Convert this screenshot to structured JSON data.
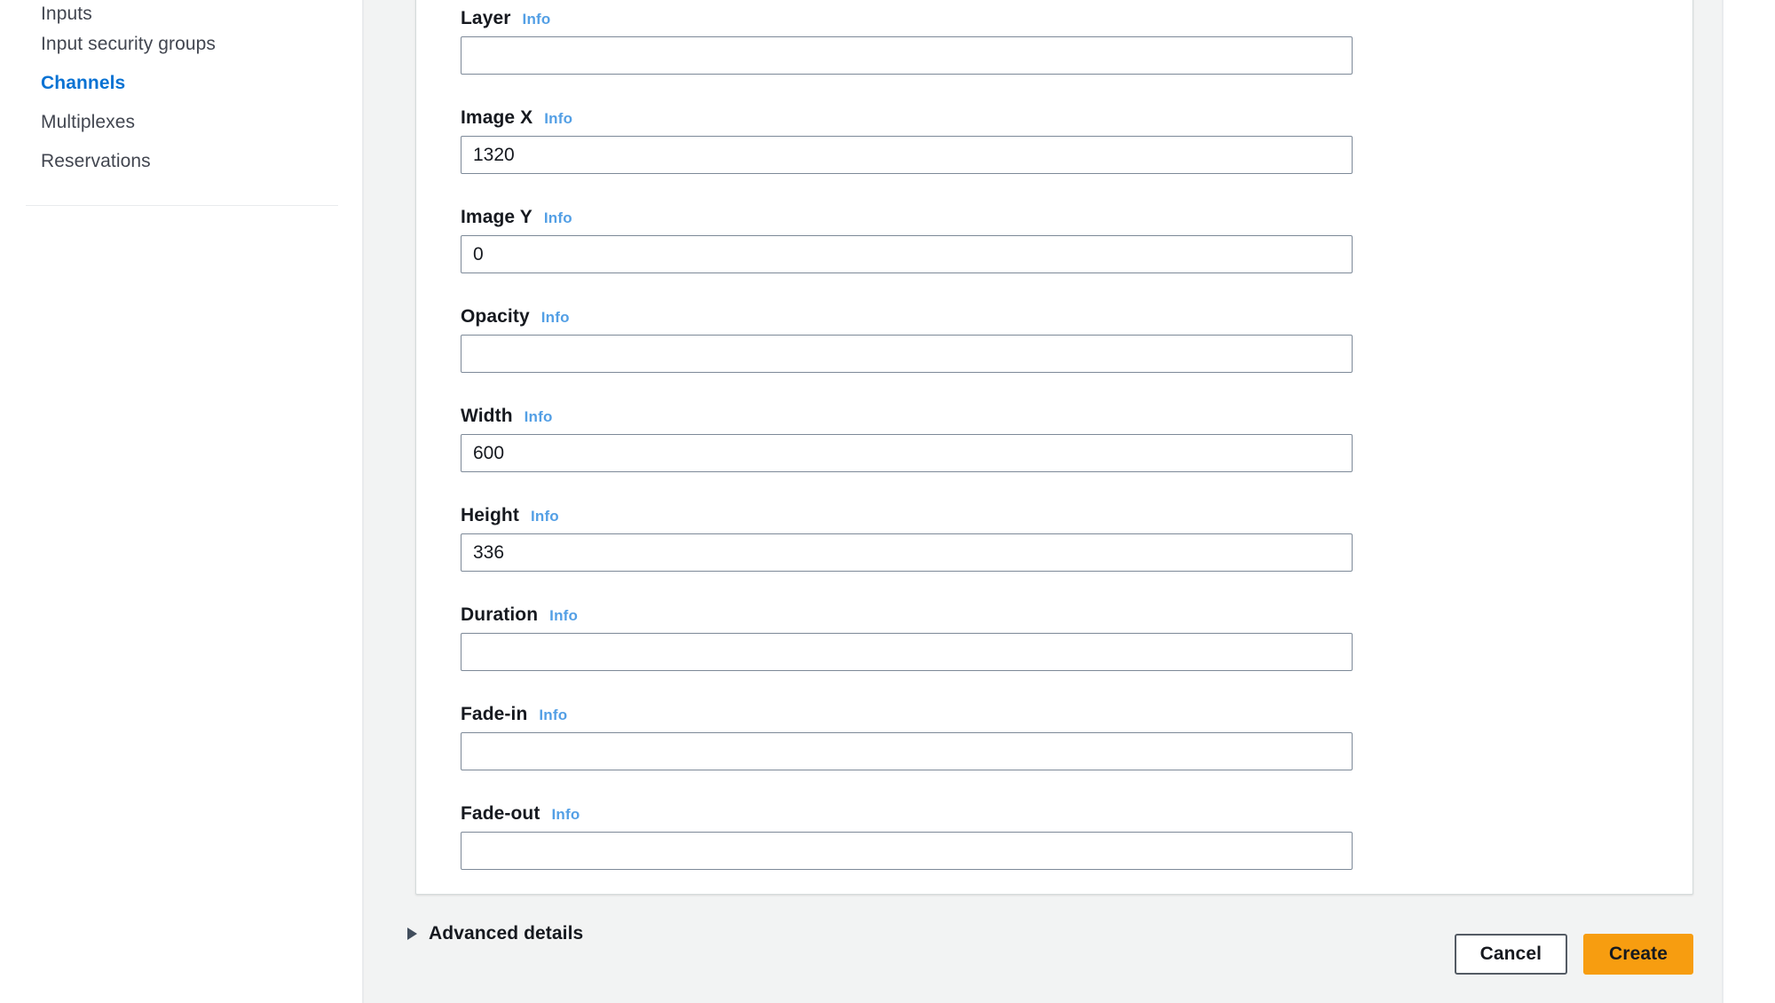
{
  "sidebar": {
    "items": [
      {
        "label": "Inputs",
        "selected": false
      },
      {
        "label": "Input security groups",
        "selected": false
      },
      {
        "label": "Channels",
        "selected": true
      },
      {
        "label": "Multiplexes",
        "selected": false
      },
      {
        "label": "Reservations",
        "selected": false
      }
    ]
  },
  "form": {
    "info_label": "Info",
    "fields": [
      {
        "label": "Layer",
        "value": "",
        "name": "layer"
      },
      {
        "label": "Image X",
        "value": "1320",
        "name": "image-x"
      },
      {
        "label": "Image Y",
        "value": "0",
        "name": "image-y"
      },
      {
        "label": "Opacity",
        "value": "",
        "name": "opacity"
      },
      {
        "label": "Width",
        "value": "600",
        "name": "width"
      },
      {
        "label": "Height",
        "value": "336",
        "name": "height"
      },
      {
        "label": "Duration",
        "value": "",
        "name": "duration"
      },
      {
        "label": "Fade-in",
        "value": "",
        "name": "fade-in"
      },
      {
        "label": "Fade-out",
        "value": "",
        "name": "fade-out"
      }
    ],
    "advanced_details_label": "Advanced details"
  },
  "actions": {
    "cancel_label": "Cancel",
    "create_label": "Create"
  },
  "colors": {
    "accent_blue": "#0972d3",
    "info_blue": "#539fe5",
    "create_orange": "#f79d10",
    "panel_bg": "#f2f3f3",
    "border": "#d5dbdb"
  }
}
